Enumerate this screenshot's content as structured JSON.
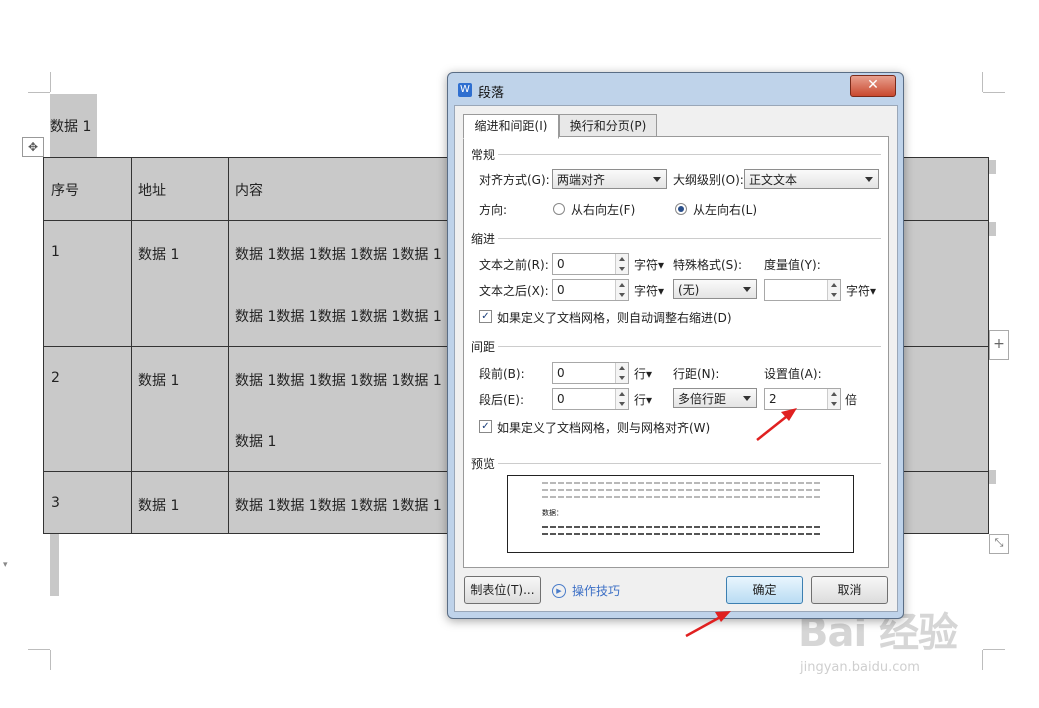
{
  "document": {
    "title_label": "数据 1",
    "table": {
      "headers": [
        "序号",
        "地址",
        "内容"
      ],
      "rows": [
        {
          "num": "1",
          "addr": "数据 1",
          "content_lines": [
            "数据 1数据 1数据 1数据 1数据 1",
            "数据 1数据 1数据 1数据 1数据 1"
          ]
        },
        {
          "num": "2",
          "addr": "数据 1",
          "content_lines": [
            "数据 1数据 1数据 1数据 1数据 1",
            "数据 1"
          ]
        },
        {
          "num": "3",
          "addr": "数据 1",
          "content_lines": [
            "数据 1数据 1数据 1数据 1数据 1"
          ]
        }
      ]
    },
    "add_button_label": "+"
  },
  "dialog": {
    "title": "段落",
    "close_label": "✕",
    "tabs": [
      {
        "label": "缩进和间距(I)",
        "active": true
      },
      {
        "label": "换行和分页(P)",
        "active": false
      }
    ],
    "general": {
      "section_label": "常规",
      "alignment_label": "对齐方式(G):",
      "alignment_value": "两端对齐",
      "outline_label": "大纲级别(O):",
      "outline_value": "正文文本",
      "direction_label": "方向:",
      "rtl_label": "从右向左(F)",
      "ltr_label": "从左向右(L)"
    },
    "indent": {
      "section_label": "缩进",
      "before_label": "文本之前(R):",
      "before_value": "0",
      "before_unit": "字符▾",
      "special_label": "特殊格式(S):",
      "special_value": "(无)",
      "measure_label": "度量值(Y):",
      "measure_value": "",
      "measure_unit": "字符▾",
      "after_label": "文本之后(X):",
      "after_value": "0",
      "after_unit": "字符▾",
      "auto_adjust_label": "如果定义了文档网格，则自动调整右缩进(D)"
    },
    "spacing": {
      "section_label": "间距",
      "before_label": "段前(B):",
      "before_value": "0",
      "before_unit": "行▾",
      "line_spacing_label": "行距(N):",
      "line_spacing_value": "多倍行距",
      "setting_label": "设置值(A):",
      "setting_value": "2",
      "setting_unit": "倍",
      "after_label": "段后(E):",
      "after_value": "0",
      "after_unit": "行▾",
      "grid_align_label": "如果定义了文档网格，则与网格对齐(W)"
    },
    "preview": {
      "section_label": "预览",
      "sample_text": "数据："
    },
    "tabs_button": "制表位(T)...",
    "tips_label": "操作技巧",
    "ok_label": "确定",
    "cancel_label": "取消"
  },
  "watermark": {
    "logo": "Bai 经验",
    "url": "jingyan.baidu.com"
  },
  "colors": {
    "table_fill": "#c9c9c9",
    "dialog_frame": "#bfd3ea",
    "annotation_arrow": "#e02020",
    "link": "#3c6fc5"
  }
}
